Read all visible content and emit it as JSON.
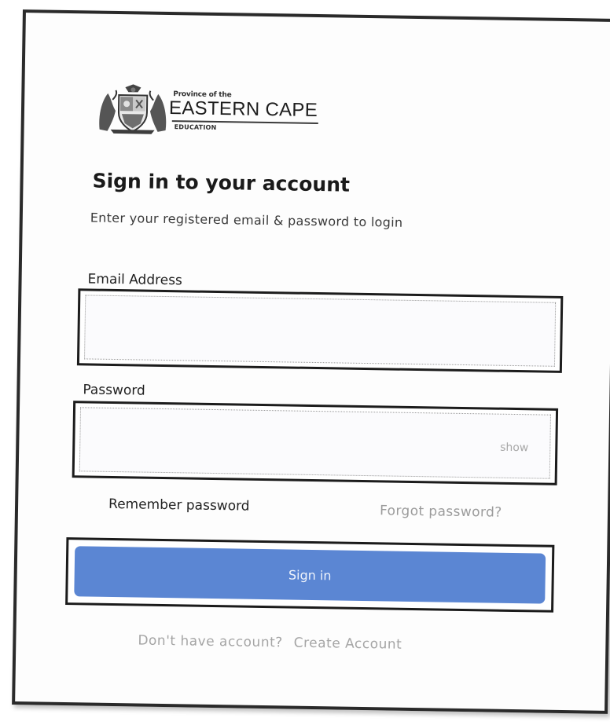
{
  "logo": {
    "province_text": "Province of the",
    "brand_text": "EASTERN CAPE",
    "sub_text": "EDUCATION"
  },
  "form": {
    "title": "Sign in to your account",
    "subtitle": "Enter your registered email & password to login",
    "email_label": "Email Address",
    "email_value": "",
    "password_label": "Password",
    "password_value": "",
    "show_toggle": "show",
    "remember_label": "Remember password",
    "forgot_link": "Forgot password?",
    "submit_label": "Sign in",
    "no_account_text": "Don't have account?",
    "create_account_link": "Create Account"
  },
  "colors": {
    "button": "#5b86d3",
    "muted_text": "#9b9b9b",
    "border": "#1c1c1c"
  },
  "icons": {
    "crest": "coat-of-arms-icon"
  }
}
